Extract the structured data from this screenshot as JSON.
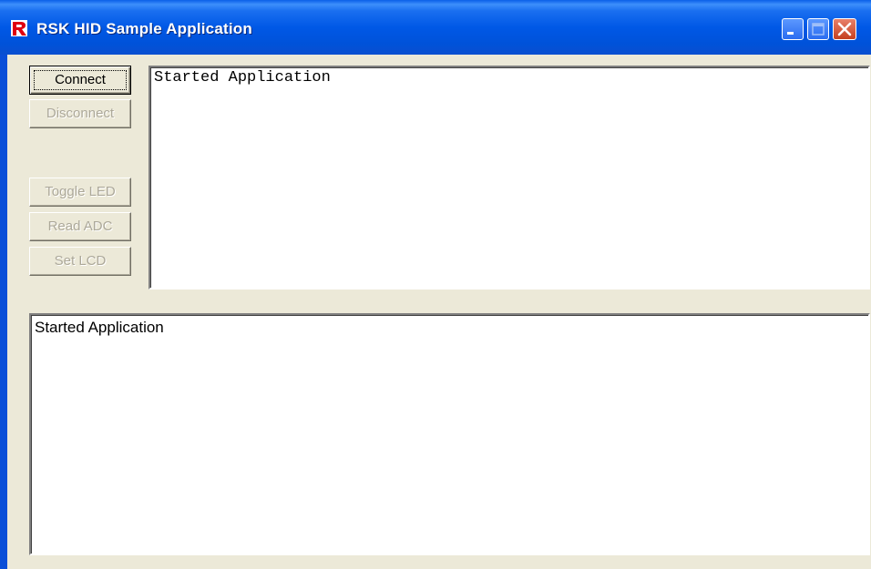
{
  "window": {
    "title": "RSK HID Sample Application",
    "icon": "renesas-r-logo",
    "controls": [
      "minimize",
      "maximize",
      "close"
    ]
  },
  "buttons": {
    "connect": {
      "label": "Connect",
      "enabled": true
    },
    "disconnect": {
      "label": "Disconnect",
      "enabled": false
    },
    "toggle_led": {
      "label": "Toggle LED",
      "enabled": false
    },
    "read_adc": {
      "label": "Read ADC",
      "enabled": false
    },
    "set_lcd": {
      "label": "Set LCD",
      "enabled": false
    }
  },
  "upper_text": "Started Application",
  "lower_text": "Started Application",
  "colors": {
    "titlebar": "#0054e3",
    "face": "#ece9d8",
    "close": "#c4401f"
  }
}
